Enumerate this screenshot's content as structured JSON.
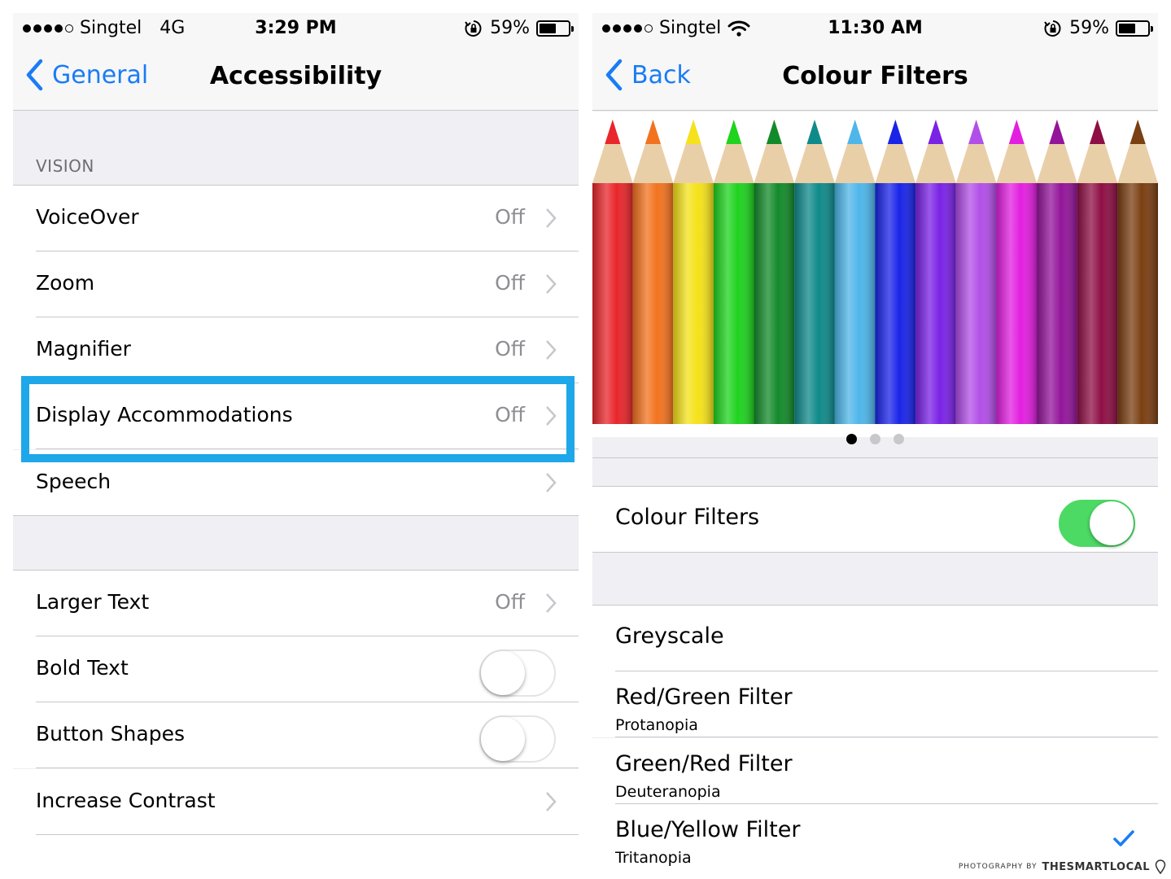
{
  "left": {
    "status": {
      "carrier": "Singtel",
      "network": "4G",
      "time": "3:29 PM",
      "battery": "59%",
      "battery_level": 0.59
    },
    "nav": {
      "back_label": "General",
      "title": "Accessibility"
    },
    "vision_header": "VISION",
    "vision_items": [
      {
        "label": "VoiceOver",
        "value": "Off"
      },
      {
        "label": "Zoom",
        "value": "Off"
      },
      {
        "label": "Magnifier",
        "value": "Off"
      },
      {
        "label": "Display Accommodations",
        "value": "Off"
      },
      {
        "label": "Speech",
        "value": ""
      }
    ],
    "text_items": [
      {
        "label": "Larger Text",
        "value": "Off"
      },
      {
        "label": "Bold Text",
        "toggle": false
      },
      {
        "label": "Button Shapes",
        "toggle": false
      },
      {
        "label": "Increase Contrast",
        "value": ""
      }
    ]
  },
  "right": {
    "status": {
      "carrier": "Singtel",
      "time": "11:30 AM",
      "battery": "59%",
      "battery_level": 0.59
    },
    "nav": {
      "back_label": "Back",
      "title": "Colour Filters"
    },
    "pencil_colors": [
      "#e8262b",
      "#f2731f",
      "#f5e21a",
      "#1fd31f",
      "#138a2a",
      "#0f8a8a",
      "#4fb6ea",
      "#1a24e8",
      "#7a22e6",
      "#b24fe8",
      "#e21fe0",
      "#93159a",
      "#8e0f45",
      "#7a3f12"
    ],
    "page_dots": 3,
    "active_dot": 0,
    "colour_filters": {
      "label": "Colour Filters",
      "toggle": true
    },
    "filters": [
      {
        "label": "Greyscale",
        "subtitle": "",
        "checked": false
      },
      {
        "label": "Red/Green Filter",
        "subtitle": "Protanopia",
        "checked": false
      },
      {
        "label": "Green/Red Filter",
        "subtitle": "Deuteranopia",
        "checked": false
      },
      {
        "label": "Blue/Yellow Filter",
        "subtitle": "Tritanopia",
        "checked": true
      }
    ]
  },
  "watermark": {
    "prefix": "PHOTOGRAPHY BY",
    "brand": "THESMARTLOCAL"
  },
  "colors": {
    "ios_blue": "#1a7cf5",
    "highlight": "#1ea7e9",
    "switch_on": "#4cd964",
    "group_bg": "#efeff4"
  }
}
